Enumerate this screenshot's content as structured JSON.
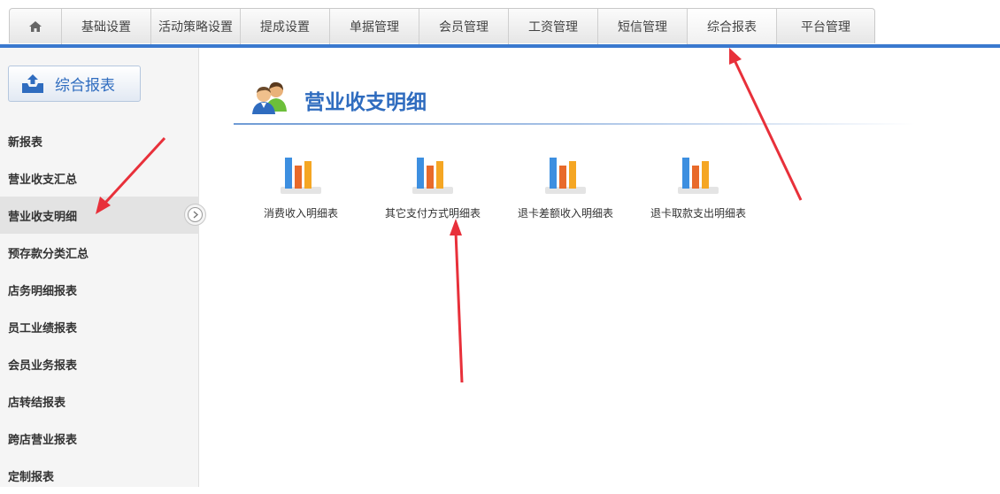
{
  "nav": {
    "items": [
      "基础设置",
      "活动策略设置",
      "提成设置",
      "单据管理",
      "会员管理",
      "工资管理",
      "短信管理",
      "综合报表",
      "平台管理"
    ],
    "active": "综合报表"
  },
  "sidebar": {
    "header": "综合报表",
    "items": [
      "新报表",
      "营业收支汇总",
      "营业收支明细",
      "预存款分类汇总",
      "店务明细报表",
      "员工业绩报表",
      "会员业务报表",
      "店转结报表",
      "跨店营业报表",
      "定制报表"
    ],
    "active": "营业收支明细"
  },
  "main": {
    "title": "营业收支明细",
    "reports": [
      "消费收入明细表",
      "其它支付方式明细表",
      "退卡差额收入明细表",
      "退卡取款支出明细表"
    ]
  },
  "colors": {
    "accent": "#3a79cf",
    "title": "#2f6cbf",
    "annotation_arrow": "#e8303a"
  }
}
